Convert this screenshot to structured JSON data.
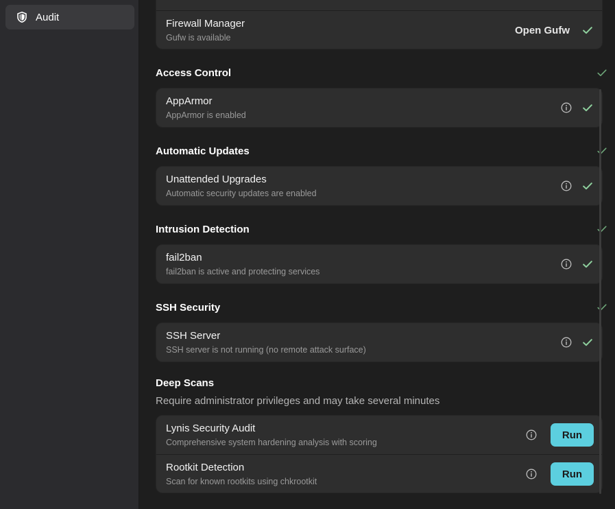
{
  "sidebar": {
    "items": [
      {
        "label": "Audit",
        "icon": "shield-icon",
        "selected": true
      }
    ]
  },
  "firewall": {
    "title": "Firewall Manager",
    "subtitle": "Gufw is available",
    "action": "Open Gufw"
  },
  "sections": {
    "access_control": {
      "title": "Access Control",
      "item_title": "AppArmor",
      "item_subtitle": "AppArmor is enabled"
    },
    "automatic_updates": {
      "title": "Automatic Updates",
      "item_title": "Unattended Upgrades",
      "item_subtitle": "Automatic security updates are enabled"
    },
    "intrusion_detection": {
      "title": "Intrusion Detection",
      "item_title": "fail2ban",
      "item_subtitle": "fail2ban is active and protecting services"
    },
    "ssh_security": {
      "title": "SSH Security",
      "item_title": "SSH Server",
      "item_subtitle": "SSH server is not running (no remote attack surface)"
    }
  },
  "deep_scans": {
    "title": "Deep Scans",
    "description": "Require administrator privileges and may take several minutes",
    "items": [
      {
        "title": "Lynis Security Audit",
        "subtitle": "Comprehensive system hardening analysis with scoring",
        "action": "Run"
      },
      {
        "title": "Rootkit Detection",
        "subtitle": "Scan for known rootkits using chkrootkit",
        "action": "Run"
      }
    ]
  },
  "colors": {
    "accent": "#5ccfdf",
    "check_green": "#8fd19e",
    "background": "#1e1e1e",
    "card": "#2e2e2e"
  }
}
